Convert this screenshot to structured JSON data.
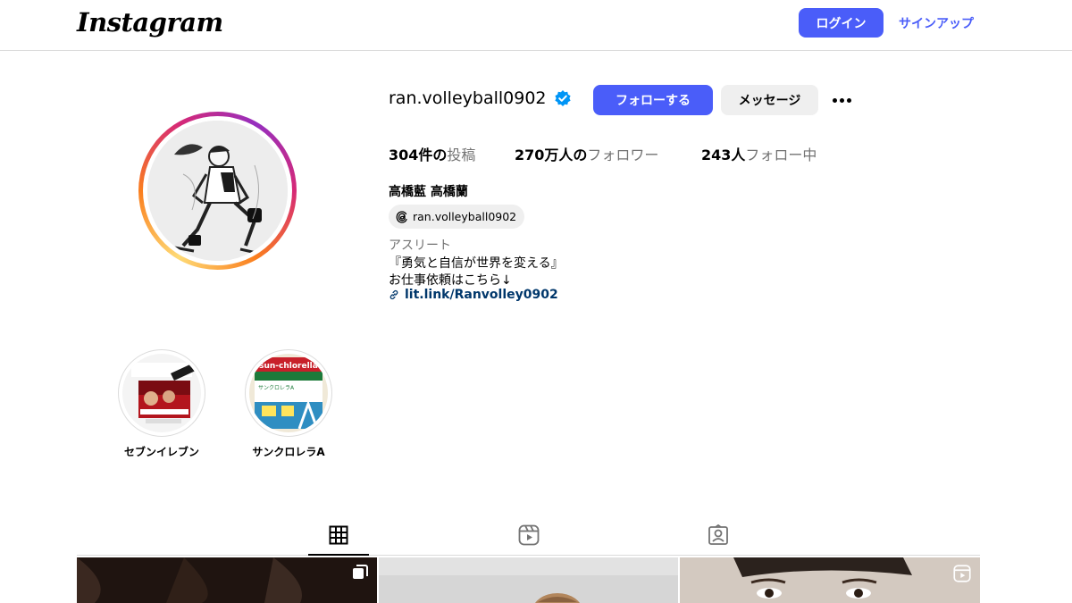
{
  "header": {
    "logo": "Instagram",
    "login_label": "ログイン",
    "signup_label": "サインアップ"
  },
  "profile": {
    "username": "ran.volleyball0902",
    "verified": true,
    "follow_label": "フォローする",
    "message_label": "メッセージ",
    "stats": {
      "posts_count": "304件の",
      "posts_label": "投稿",
      "followers_count": "270万人の",
      "followers_label": "フォロワー",
      "following_count": "243人",
      "following_label": "フォロー中"
    },
    "full_name": "高橋藍 高橋蘭",
    "threads_handle": "ran.volleyball0902",
    "category": "アスリート",
    "bio_line1": "『勇気と自信が世界を変える』",
    "bio_line2": "お仕事依頼はこちら↓",
    "link": "lit.link/Ranvolley0902"
  },
  "highlights": [
    {
      "label": "セブンイレブン"
    },
    {
      "label": "サンクロレラA"
    }
  ],
  "highlight_art": {
    "sunchlorella_text": "sun-chlorella",
    "sunchlorella_sub": "サンクロレラA"
  },
  "tabs": [
    {
      "name": "posts",
      "icon": "grid-icon",
      "active": true
    },
    {
      "name": "reels",
      "icon": "reels-icon",
      "active": false
    },
    {
      "name": "tagged",
      "icon": "tagged-icon",
      "active": false
    }
  ],
  "colors": {
    "accent": "#4a5df9",
    "link": "#00376b",
    "secondary_text": "#737373",
    "border": "#dbdbdb"
  }
}
